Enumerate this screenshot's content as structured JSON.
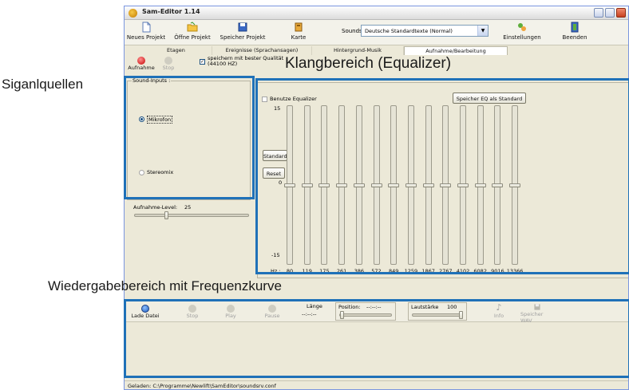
{
  "window": {
    "title": "Sam-Editor 1.14"
  },
  "toolbar": {
    "new_project": "Neues Projekt",
    "open_project": "Öffne Projekt",
    "save_project": "Speicher Projekt",
    "card": "Karte",
    "sounds_label": "Sounds:",
    "sounds_value": "Deutsche Standardtexte (Normal)",
    "settings": "Einstellungen",
    "quit": "Beenden"
  },
  "tabs": [
    {
      "label": "Etagen"
    },
    {
      "label": "Ereignisse (Sprachansagen)"
    },
    {
      "label": "Hintergrund-Musik"
    },
    {
      "label": "Aufnahme/Bearbeitung"
    }
  ],
  "record_bar": {
    "record": "Aufnahme",
    "stop": "Stop",
    "quality_line1": "speichern mit bester Qualität",
    "quality_line2": "(44100 HZ)",
    "quality_checked": true
  },
  "inputs": {
    "legend": "Sound-Inputs :",
    "mic": "Mikrofon",
    "stereo": "Stereomix",
    "selected": "mic"
  },
  "level": {
    "label": "Aufnahme-Level:",
    "value": "25",
    "fraction": 0.28
  },
  "equalizer": {
    "use_label": "Benutze Equalizer",
    "enabled": false,
    "save_default": "Speicher EQ als Standard",
    "standard": "Standard",
    "reset": "Reset",
    "scale_top": "15",
    "scale_mid": "0",
    "scale_bottom": "-15",
    "hz_label": "Hz :",
    "bands": [
      "80",
      "119",
      "175",
      "261",
      "386",
      "572",
      "849",
      "1259",
      "1867",
      "2767",
      "4102",
      "6082",
      "9016",
      "13366"
    ]
  },
  "playback": {
    "load": "Lade Datei",
    "stop": "Stop",
    "play": "Play",
    "pause": "Pause",
    "length_label": "Länge",
    "length_value": "--:--:--",
    "position_label": "Position:",
    "position_value": "--:--:--",
    "volume_label": "Lautstärke",
    "volume_value": "100",
    "info": "Info",
    "save_wav": "Speicher WAV"
  },
  "status": {
    "text": "Geladen:   C:\\Programme\\Newlift\\SamEditor\\soundsrv.conf"
  },
  "annotations": {
    "sources": "Siganlquellen",
    "equalizer": "Klangbereich (Equalizer)",
    "playback": "Wiedergabebereich mit Frequenzkurve"
  },
  "colors": {
    "accent": "#1f71b8",
    "window_bg": "#ece9d8"
  }
}
